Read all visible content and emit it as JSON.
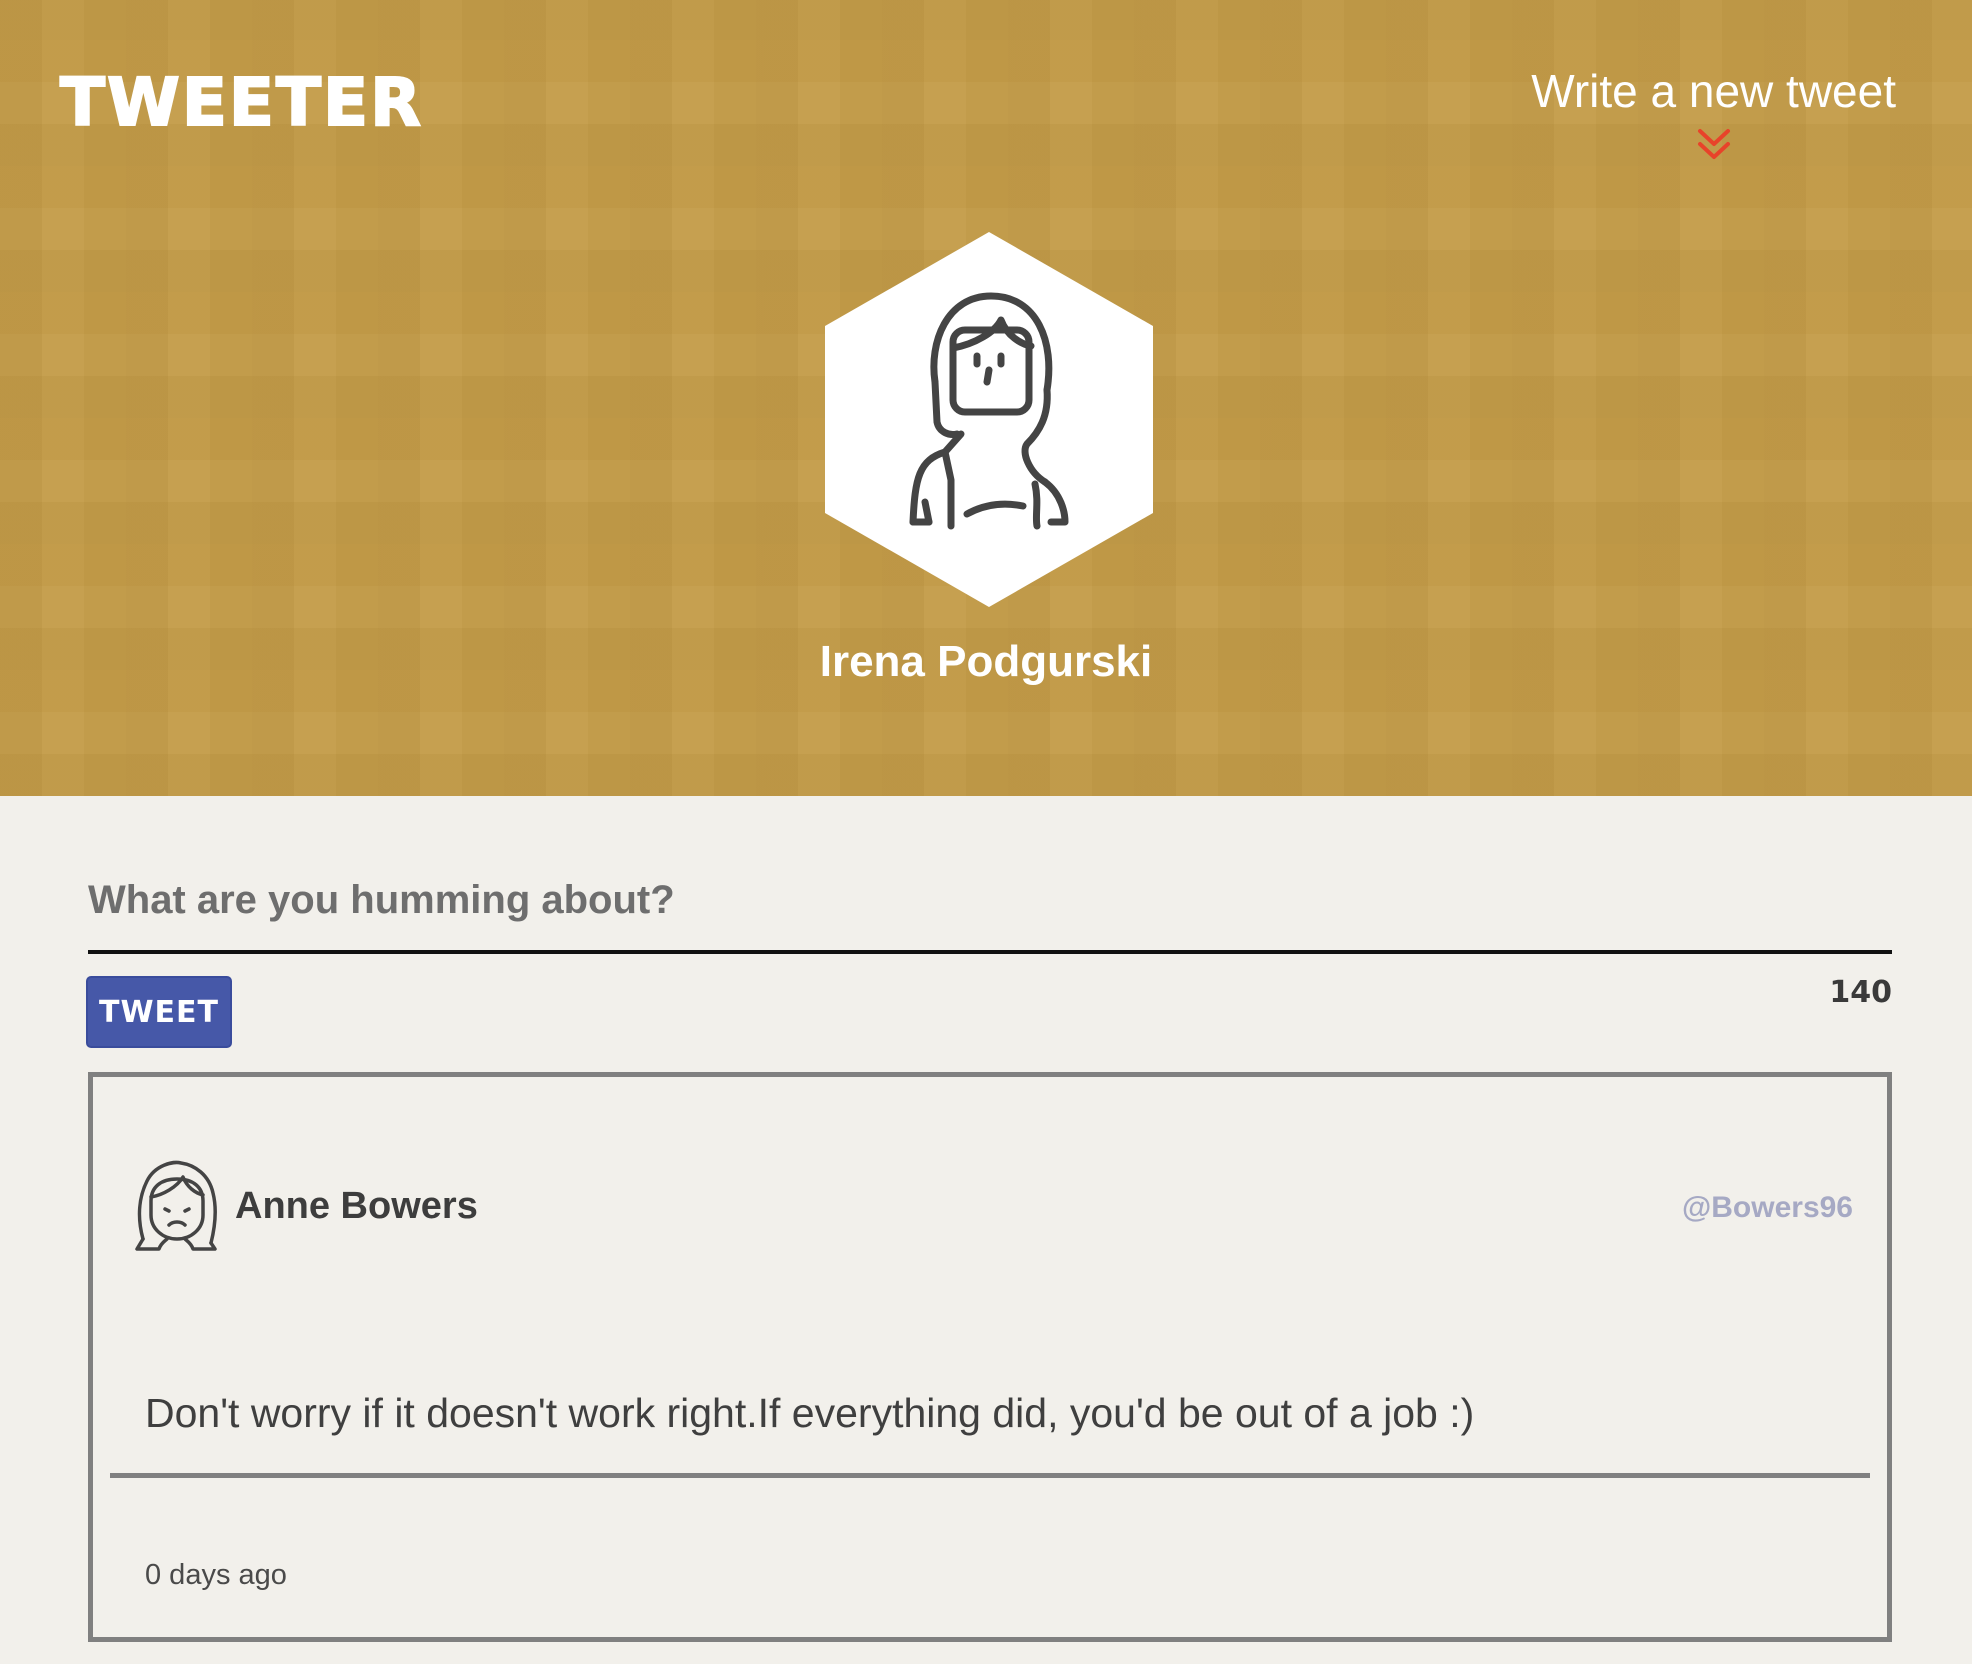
{
  "header": {
    "brand": "TWEETER",
    "write_link": "Write a new tweet",
    "chevron_icon": "double-chevron-down-icon",
    "profile_name": "Irena Podgurski",
    "avatar_icon": "woman-avatar-icon",
    "background_color": "#c49c48",
    "chevron_color": "#e8432a"
  },
  "compose": {
    "placeholder": "What are you humming about?",
    "value": "",
    "button_label": "TWEET",
    "char_count": "140",
    "button_color": "#4658a8"
  },
  "tweets": [
    {
      "author": "Anne Bowers",
      "handle": "@Bowers96",
      "avatar_icon": "sad-woman-avatar-icon",
      "text": "Don't worry if it doesn't work right.If everything did, you'd be out of a job :)",
      "time": "0 days ago"
    }
  ]
}
